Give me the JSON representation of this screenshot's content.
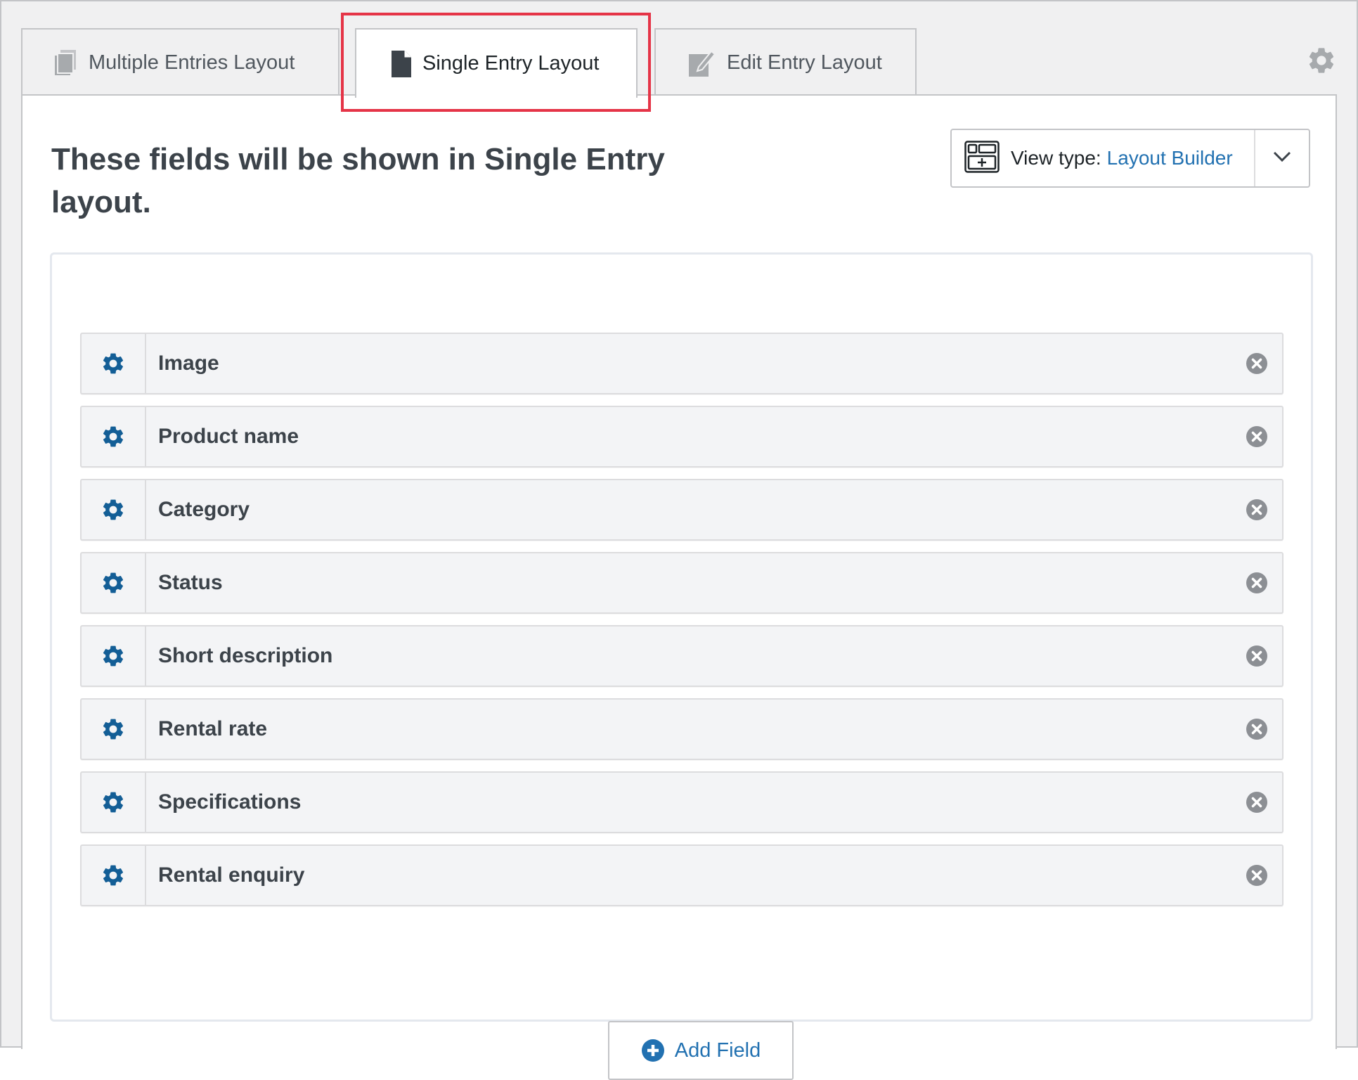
{
  "tabs": [
    {
      "label": "Multiple Entries Layout",
      "icon": "copy-icon",
      "active": false
    },
    {
      "label": "Single Entry Layout",
      "icon": "document-icon",
      "active": true
    },
    {
      "label": "Edit Entry Layout",
      "icon": "edit-icon",
      "active": false
    }
  ],
  "settings_icon": "gear-icon",
  "heading": "These fields will be shown in Single Entry layout.",
  "view_type": {
    "label": "View type:",
    "value": "Layout Builder",
    "icon": "layout-builder-icon",
    "toggle_icon": "chevron-down-icon"
  },
  "fields": [
    {
      "label": "Image"
    },
    {
      "label": "Product name"
    },
    {
      "label": "Category"
    },
    {
      "label": "Status"
    },
    {
      "label": "Short description"
    },
    {
      "label": "Rental rate"
    },
    {
      "label": "Specifications"
    },
    {
      "label": "Rental enquiry"
    }
  ],
  "add_field": {
    "label": "Add Field",
    "icon": "plus-circle-icon"
  },
  "colors": {
    "accent": "#2271b1",
    "gear": "#135e96",
    "highlight": "#e53447",
    "remove": "#8c8f94"
  }
}
